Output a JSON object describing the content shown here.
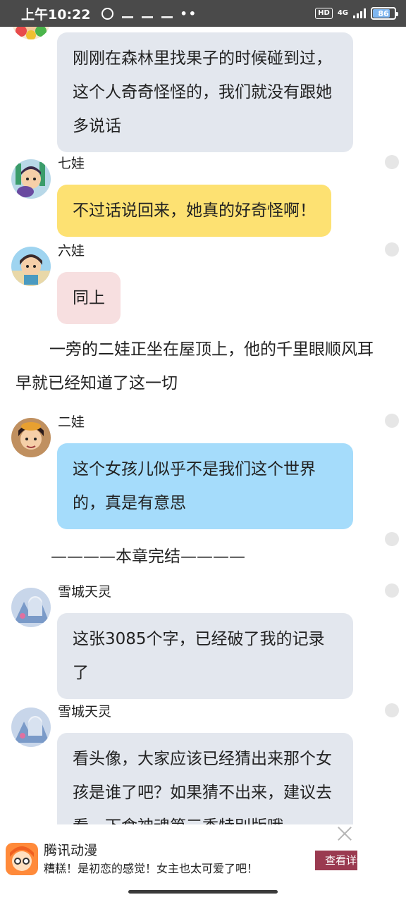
{
  "status_bar": {
    "time": "上午10:22",
    "hd": "HD",
    "network": "4G",
    "battery": "86"
  },
  "messages": [
    {
      "id": "msg-0",
      "sender": "",
      "text": "刚刚在森林里找果子的时候碰到过，这个人奇奇怪怪的，我们就没有跟她多说话",
      "bubble_color": "#e3e7ee",
      "avatar_icon": "flower-child-avatar-icon"
    },
    {
      "id": "msg-1",
      "sender": "七娃",
      "text": "不过话说回来，她真的好奇怪啊！",
      "bubble_color": "#fde172",
      "avatar_icon": "qiwa-avatar-icon"
    },
    {
      "id": "msg-2",
      "sender": "六娃",
      "text": "同上",
      "bubble_color": "#f7dfe0",
      "avatar_icon": "liuwa-avatar-icon"
    },
    {
      "id": "msg-3",
      "sender": "二娃",
      "text": "这个女孩儿似乎不是我们这个世界的，真是有意思",
      "bubble_color": "#a5dcfb",
      "avatar_icon": "erwa-avatar-icon"
    },
    {
      "id": "msg-4",
      "sender": "雪城天灵",
      "text": "这张3085个字，已经破了我的记录了",
      "bubble_color": "#e3e7ee",
      "avatar_icon": "xuecheng-avatar-icon"
    },
    {
      "id": "msg-5",
      "sender": "雪城天灵",
      "text": "看头像，大家应该已经猜出来那个女孩是谁了吧？如果猜不出来，建议去看一下食神魂第三季特别版哦",
      "bubble_color": "#e3e7ee",
      "avatar_icon": "xuecheng-avatar-icon"
    }
  ],
  "narration": "一旁的二娃正坐在屋顶上，他的千里眼顺风耳早就已经知道了这一切",
  "chapter_end": "————本章完结————",
  "ad": {
    "title": "腾讯动漫",
    "description": "糟糕！是初恋的感觉！女主也太可爱了吧！",
    "button": "查看详情",
    "logo_icon": "tencent-comic-logo-icon",
    "close_icon": "close-icon"
  }
}
